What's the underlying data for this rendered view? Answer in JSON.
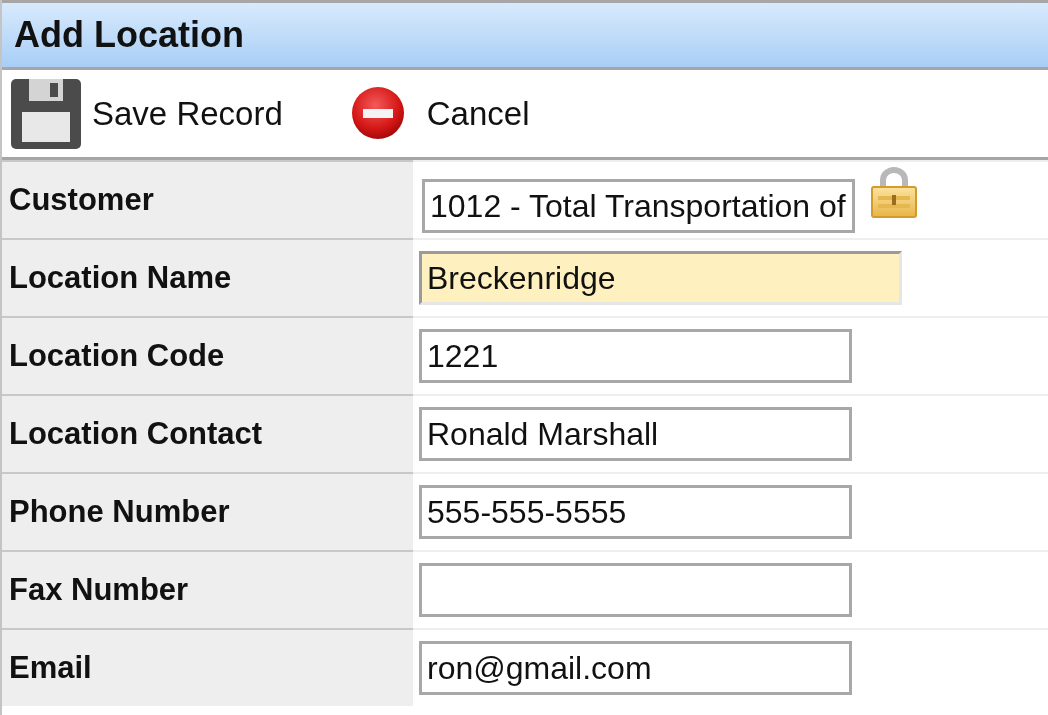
{
  "window": {
    "title": "Add Location"
  },
  "toolbar": [
    {
      "kind": "save",
      "label": "Save Record"
    },
    {
      "kind": "cancel",
      "label": "Cancel"
    }
  ],
  "fields": [
    {
      "label": "Customer",
      "value": "1012 - Total Transportation of",
      "locked": true,
      "highlighted": false
    },
    {
      "label": "Location Name",
      "value": "Breckenridge",
      "locked": false,
      "highlighted": true
    },
    {
      "label": "Location Code",
      "value": "1221",
      "locked": false,
      "highlighted": false
    },
    {
      "label": "Location Contact",
      "value": "Ronald Marshall",
      "locked": false,
      "highlighted": false
    },
    {
      "label": "Phone Number",
      "value": "555-555-5555",
      "locked": false,
      "highlighted": false
    },
    {
      "label": "Fax Number",
      "locked": false,
      "highlighted": false
    },
    {
      "label": "Email",
      "value": "ron@gmail.com",
      "locked": false,
      "highlighted": false
    }
  ]
}
